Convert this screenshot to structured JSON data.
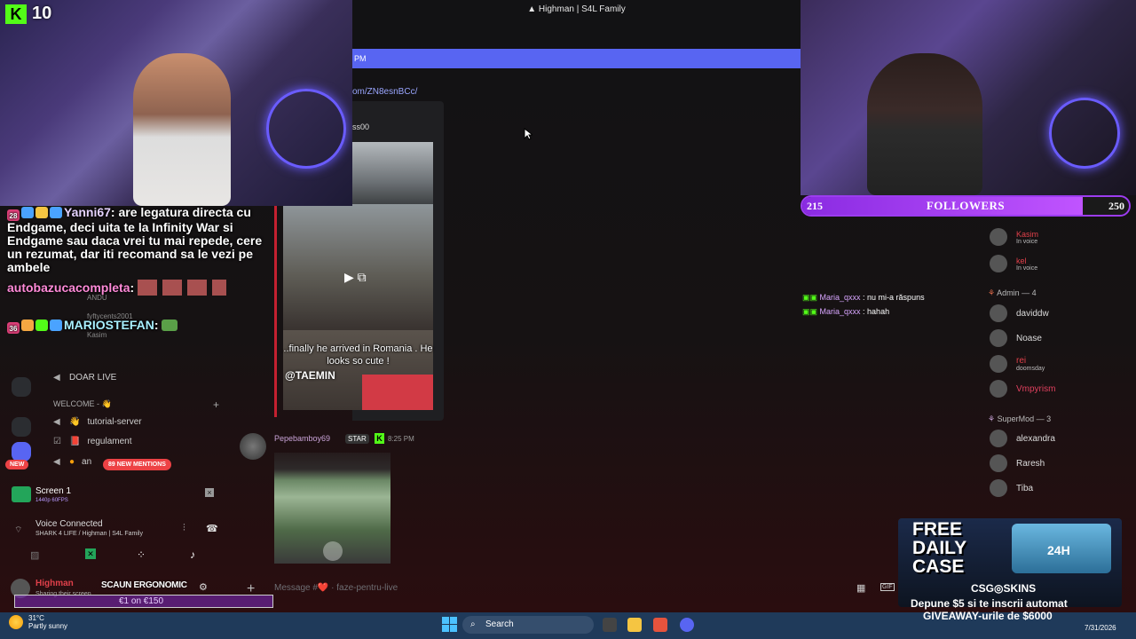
{
  "window": {
    "title": "Highman | S4L Family"
  },
  "banner": {
    "text": "PM"
  },
  "embed": {
    "link": "om/ZN8esnBCc/",
    "author": "ss00",
    "video_caption": "..finally he arrived in Romania . He looks so cute !",
    "video_user": "@TAEMIN"
  },
  "message": {
    "author": "Pepebamboy69",
    "badge": "STAR",
    "time": "8:25 PM",
    "input_placeholder": "Message #❤️ · faze-pentru-live"
  },
  "kick": {
    "count": "10"
  },
  "followers": {
    "label": "FOLLOWERS",
    "current": "215",
    "goal": "250",
    "progress": 0.86
  },
  "overlay_chat": [
    {
      "user": "Yanni67",
      "badge_count": "28",
      "text": "are legatura directa cu Endgame, deci uita te la Infinity War si Endgame sau daca vrei tu mai repede, cere un rezumat, dar iti recomand sa le vezi pe ambele"
    },
    {
      "user": "autobazucacompleta",
      "text": ""
    },
    {
      "user": "MARIOSTEFAN",
      "badge_count": "36",
      "text": ""
    }
  ],
  "voice_chat_lines": [
    {
      "user": "Maria_qxxx",
      "text": "nu mi-a răspuns"
    },
    {
      "user": "Maria_qxxx",
      "text": "hahah"
    }
  ],
  "members": {
    "in_voice": [
      {
        "name": "Kasim",
        "status": "In voice",
        "color": "#e0404a"
      },
      {
        "name": "kel",
        "status": "In voice",
        "color": "#e0404a"
      }
    ],
    "admin_header": "Admin — 4",
    "admins": [
      {
        "name": "daviddw",
        "status": "",
        "color": "#ffffff"
      },
      {
        "name": "Noase",
        "status": "",
        "color": "#ffffff"
      },
      {
        "name": "rei",
        "status": "doomsday",
        "color": "#e0404a"
      },
      {
        "name": "Vmpyrism",
        "status": "",
        "color": "#e0405e"
      }
    ],
    "supermod_header": "SuperMod — 3",
    "supermods": [
      {
        "name": "alexandra",
        "color": "#ffffff"
      },
      {
        "name": "Raresh",
        "color": "#ffffff"
      },
      {
        "name": "Tiba",
        "color": "#ffffff"
      }
    ]
  },
  "sidebar": {
    "new_badge": "NEW",
    "mentions": "89 NEW MENTIONS",
    "channels": [
      {
        "label": "DOAR LIVE"
      },
      {
        "label": "WELCOME - 👋"
      },
      {
        "label": "tutorial-server"
      },
      {
        "label": "regulament"
      },
      {
        "label": "an"
      }
    ],
    "overlay_names": [
      "ANDU",
      "fyftycents2001",
      "Kasim"
    ]
  },
  "screen_share": {
    "title": "Screen 1",
    "quality": "1440p 60FPS"
  },
  "voice": {
    "status": "Voice Connected",
    "channel": "SHARK 4 LIFE / Highman | S4L Family"
  },
  "user": {
    "name": "Highman",
    "sub": "Sharing their screen",
    "promo": "SCAUN ERGONOMIC",
    "promo_price": "€1 on €150"
  },
  "promo": {
    "free": "FREE",
    "daily": "DAILY",
    "case": "CASE",
    "timer": "24H",
    "brand": "CSG◎SKINS",
    "line1": "Depune $5 si te inscrii automat",
    "line2": "GIVEAWAY-urile de $6000"
  },
  "taskbar": {
    "temp": "31°C",
    "weather": "Partly sunny",
    "search": "Search",
    "date": "7/31/2026"
  }
}
